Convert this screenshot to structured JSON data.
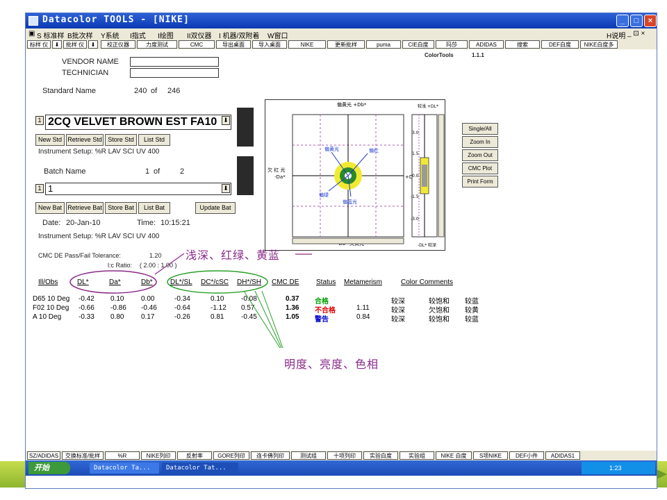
{
  "window": {
    "title": "Datacolor TOOLS  -  [NIKE]"
  },
  "menubar": {
    "items": [
      "S 标准样",
      "B批次样",
      "Y系统",
      "I指式",
      "I绘图",
      "II双仪器",
      "I 机器/双附着",
      "W窗口"
    ],
    "right": [
      "H说明",
      "_  ⊡  ×"
    ]
  },
  "toolbar": {
    "items": [
      "标样 仪",
      "⬇",
      "批样 仪",
      "⬇",
      "校正仪器",
      "力度测试",
      "CMC",
      "导出桌面",
      "导入桌面",
      "NIKE",
      "更新批样",
      "puma",
      "CIE白度",
      "玛莎",
      "ADIDAS",
      "搜索",
      "DEF白度",
      "NIKE白度多"
    ]
  },
  "header": {
    "app_name": "ColorTools",
    "version": "1.1.1"
  },
  "form": {
    "vendor_label": "VENDOR NAME",
    "technician_label": "TECHNICIAN",
    "vendor_value": "",
    "technician_value": "",
    "standard_name_label": "Standard Name",
    "std_index": "240",
    "of1": "of",
    "std_total": "246",
    "std_prefix": "1",
    "std_name_value": "2CQ VELVET BROWN EST FA10",
    "std_buttons": [
      "New Std",
      "Retrieve Std",
      "Store Std",
      "List Std"
    ],
    "instrument_setup1": "Instrument Setup:  %R LAV  SCI UV 400",
    "batch_name_label": "Batch Name",
    "batch_index": "1",
    "of2": "of",
    "batch_total": "2",
    "batch_prefix": "1",
    "batch_value": "1",
    "batch_buttons": [
      "New Bat",
      "Retrieve Bat",
      "Store Bat",
      "List Bat",
      "Update Bat"
    ],
    "date_label": "Date:",
    "date_value": "20-Jan-10",
    "time_label": "Time:",
    "time_value": "10:15:21",
    "instrument_setup2": "Instrument Setup:  %R LAV  SCI UV 400",
    "tolerance_label": "CMC DE Pass/Fail Tolerance:",
    "tolerance_value": "1.20",
    "lc_label": "l:c Ratio:",
    "lc_value": "( 2.00 : 1.00 )"
  },
  "plot": {
    "top_label": "偏黄光\n+Db*",
    "bottom_label": "-Db*\n欠黄光",
    "left_label": "欠\n红\n光",
    "left_axis": "-Da*",
    "right_label": "+Da*",
    "points": [
      "偏黄光",
      "偏红",
      "偏绿",
      "偏蓝光"
    ],
    "side_top": "较浅\n+DL*",
    "side_bottom": "-DL*\n较深",
    "side_ticks": [
      "3.0",
      "1.5",
      "0.0",
      "-1.5",
      "-3.0"
    ]
  },
  "right_buttons": [
    "Single/All",
    "Zoom In",
    "Zoom Out",
    "CMC Plot",
    "Print Form"
  ],
  "table": {
    "headers": [
      "Ill/Obs",
      "DL*",
      "Da*",
      "Db*",
      "DL*/SL",
      "DC*/cSC",
      "DH*/SH",
      "CMC DE",
      "Status",
      "Metamerism",
      "Color Comments"
    ],
    "rows": [
      [
        "D65 10 Deg",
        "-0.42",
        "0.10",
        "0.00",
        "-0.34",
        "0.10",
        "-0.08",
        "0.37",
        "合格",
        "",
        "较深",
        "较饱和",
        "较蓝"
      ],
      [
        "F02 10 Deg",
        "-0.66",
        "-0.86",
        "-0.46",
        "-0.64",
        "-1.12",
        "0.57",
        "1.36",
        "不合格",
        "1.11",
        "较深",
        "欠饱和",
        "较黄"
      ],
      [
        "A 10 Deg",
        "-0.33",
        "0.80",
        "0.17",
        "-0.26",
        "0.81",
        "-0.45",
        "1.05",
        "警告",
        "0.84",
        "较深",
        "较饱和",
        "较蓝"
      ]
    ]
  },
  "annotations": {
    "top": "浅深、红绿、黄蓝",
    "bottom": "明度、亮度、色相"
  },
  "bottombar": {
    "items": [
      "SZ/ADIDAS",
      "交换标准/批样",
      "%R",
      "NIKE列印",
      "反射率",
      "GORE列印",
      "连卡佛列印",
      "测试组",
      "十项列印",
      "实验白度",
      "实验组",
      "NIKE 白度",
      "S项NIKE",
      "DEF小件",
      "ADIDAS1"
    ]
  },
  "taskbar": {
    "start": "开始",
    "tasks": [
      "Datacolor Ta...",
      "Datacolor Tat..."
    ],
    "tray": "1:23"
  },
  "colors": {
    "titlebar": "#0a39b4",
    "green_band": "#8db52f",
    "pass": "#00a000",
    "fail": "#e00000",
    "warn": "#0000d0",
    "annotation": "#8a2a8a"
  }
}
